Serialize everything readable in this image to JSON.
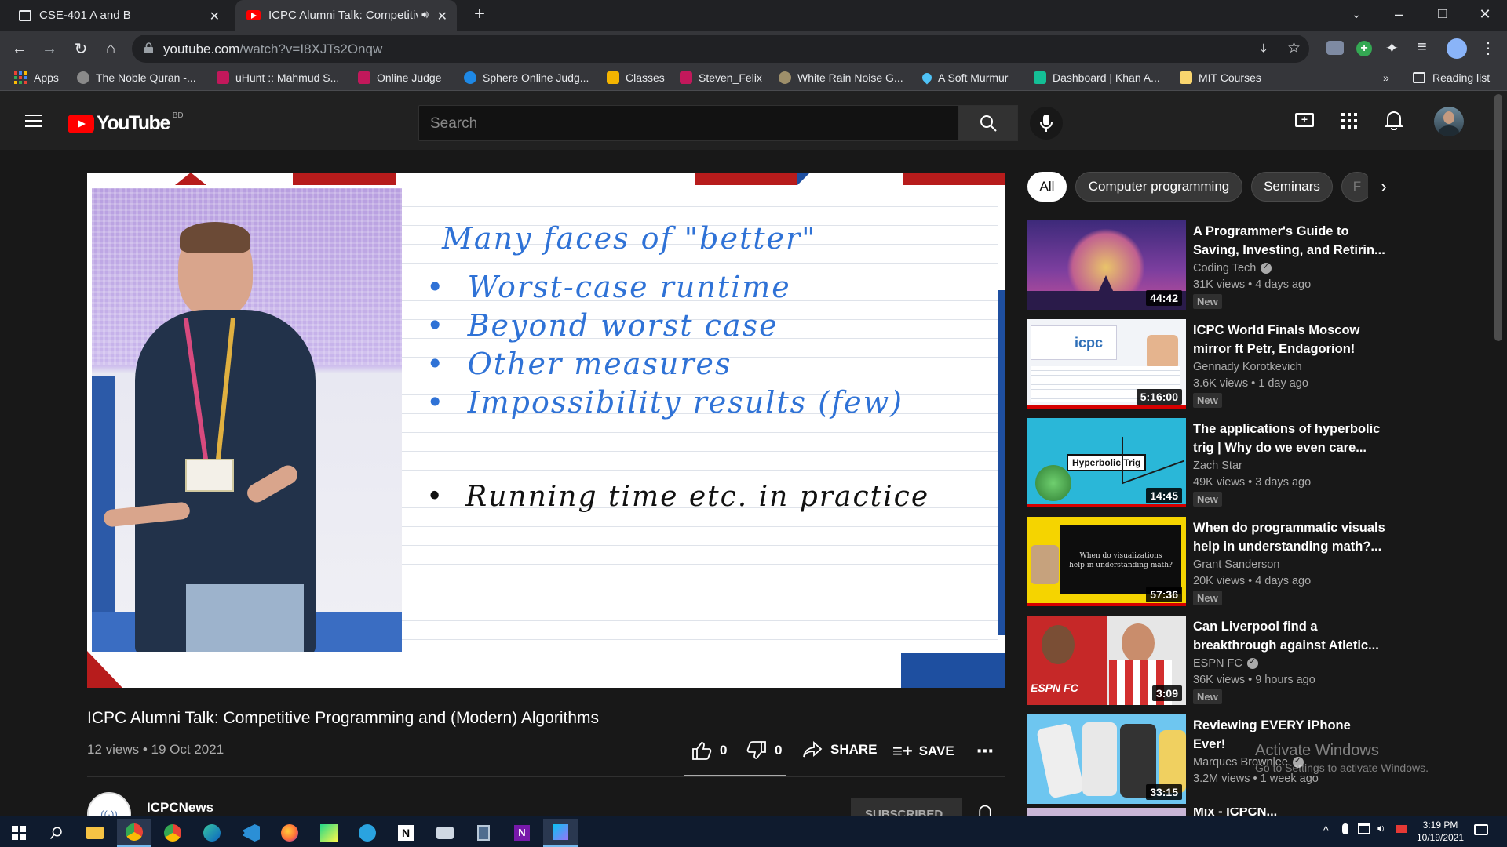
{
  "browser": {
    "tabs": [
      {
        "title": "CSE-401 A and B",
        "active": false
      },
      {
        "title": "ICPC Alumni Talk: Competitiv",
        "active": true
      }
    ],
    "url_host": "youtube.com",
    "url_path": "/watch?v=I8XJTs2Onqw",
    "bookmarks": [
      {
        "label": "Apps",
        "icon": "apps-grid-icon",
        "color": "#4285f4"
      },
      {
        "label": "The Noble Quran -...",
        "icon": "quran-icon",
        "color": "#8a8a8a"
      },
      {
        "label": "uHunt :: Mahmud S...",
        "icon": "uva-icon",
        "color": "#c2185b"
      },
      {
        "label": "Online Judge",
        "icon": "uva-icon",
        "color": "#c2185b"
      },
      {
        "label": "Sphere Online Judg...",
        "icon": "spoj-icon",
        "color": "#1e88e5"
      },
      {
        "label": "Classes",
        "icon": "classroom-icon",
        "color": "#f4b400"
      },
      {
        "label": "Steven_Felix",
        "icon": "uva-icon",
        "color": "#c2185b"
      },
      {
        "label": "White Rain Noise G...",
        "icon": "noise-icon",
        "color": "#9e8f6a"
      },
      {
        "label": "A Soft Murmur",
        "icon": "droplet-icon",
        "color": "#4fc3f7"
      },
      {
        "label": "Dashboard | Khan A...",
        "icon": "khan-icon",
        "color": "#14bf96"
      },
      {
        "label": "MIT Courses",
        "icon": "folder-icon",
        "color": "#f9d56e"
      }
    ],
    "reading_list": "Reading list"
  },
  "youtube": {
    "logo_text": "YouTube",
    "region": "BD",
    "search_placeholder": "Search",
    "chips": [
      "All",
      "Computer programming",
      "Seminars",
      "F"
    ],
    "video": {
      "title": "ICPC Alumni Talk: Competitive Programming and (Modern) Algorithms",
      "meta": "12 views • 19 Oct 2021",
      "likes": "0",
      "dislikes": "0",
      "share": "SHARE",
      "save": "SAVE",
      "channel": "ICPCNews",
      "subscribe": "SUBSCRIBED"
    },
    "slide": {
      "heading": "Many faces of \"better\"",
      "bullets": [
        "Worst-case runtime",
        "Beyond worst case",
        "Other measures",
        "Impossibility results (few)"
      ],
      "extra": "Running time etc. in practice"
    },
    "recommendations": [
      {
        "title": "A Programmer's Guide to Saving, Investing, and Retirin...",
        "channel": "Coding Tech",
        "verified": true,
        "stats": "31K views • 4 days ago",
        "badge": "New",
        "duration": "44:42",
        "thumb_color": "#5b3b8c"
      },
      {
        "title": "ICPC World Finals Moscow mirror ft Petr, Endagorion!",
        "channel": "Gennady Korotkevich",
        "verified": false,
        "stats": "3.6K views • 1 day ago",
        "badge": "New",
        "duration": "5:16:00",
        "thumb_color": "#e9edf3"
      },
      {
        "title": "The applications of hyperbolic trig | Why do we even care...",
        "channel": "Zach Star",
        "verified": false,
        "stats": "49K views • 3 days ago",
        "badge": "New",
        "duration": "14:45",
        "thumb_color": "#29b6d3"
      },
      {
        "title": "When do programmatic visuals help in understanding math?...",
        "channel": "Grant Sanderson",
        "verified": false,
        "stats": "20K views • 4 days ago",
        "badge": "New",
        "duration": "57:36",
        "thumb_color": "#f5d400"
      },
      {
        "title": "Can Liverpool find a breakthrough against Atletic...",
        "channel": "ESPN FC",
        "verified": true,
        "stats": "36K views • 9 hours ago",
        "badge": "New",
        "duration": "3:09",
        "thumb_color": "#c62828"
      },
      {
        "title": "Reviewing EVERY iPhone Ever!",
        "channel": "Marques Brownlee",
        "verified": true,
        "stats": "3.2M views • 1 week ago",
        "badge": "",
        "duration": "33:15",
        "thumb_color": "#6ec6f0"
      }
    ],
    "next_partial_title": "Mix - ICPCN..."
  },
  "watermark": {
    "line1": "Activate Windows",
    "line2": "Go to Settings to activate Windows."
  },
  "taskbar": {
    "time": "3:19 PM",
    "date": "10/19/2021"
  }
}
